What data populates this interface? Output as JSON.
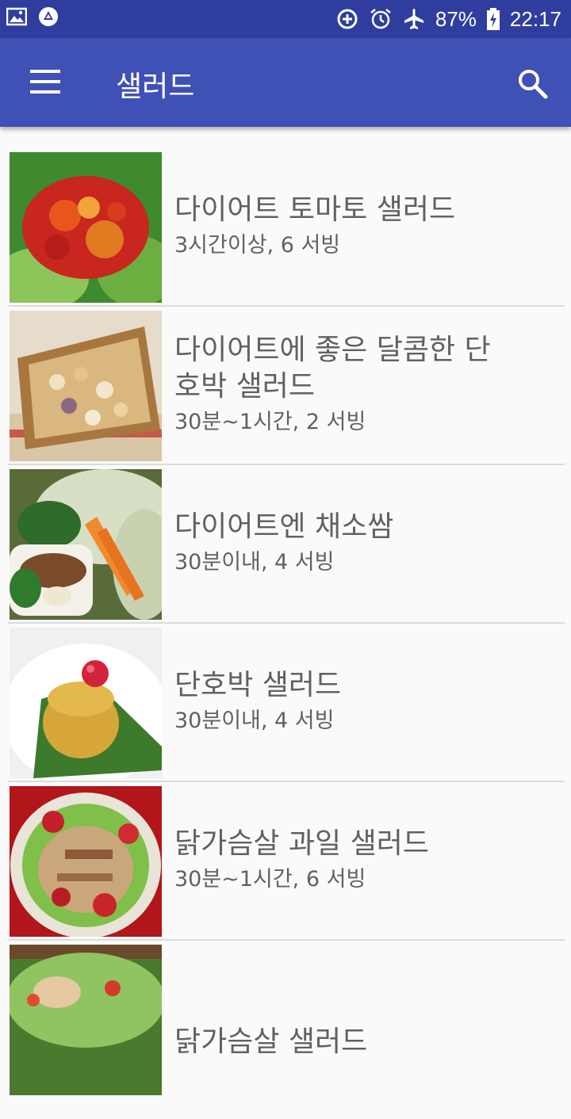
{
  "status_bar": {
    "icons_left": [
      "gallery-icon",
      "drive-icon"
    ],
    "battery_percent": "87%",
    "time": "22:17",
    "icons_right": [
      "data-saver-icon",
      "alarm-icon",
      "airplane-mode-icon",
      "battery-charging-icon"
    ]
  },
  "app_bar": {
    "title": "샐러드",
    "menu_icon": "hamburger-menu-icon",
    "search_icon": "search-icon"
  },
  "recipes": [
    {
      "name": "다이어트 토마토 샐러드",
      "meta": "3시간이상, 6 서빙"
    },
    {
      "name": "다이어트에 좋은 달콤한 단호박 샐러드",
      "meta": "30분~1시간, 2 서빙"
    },
    {
      "name": "다이어트엔 채소쌈",
      "meta": "30분이내, 4 서빙"
    },
    {
      "name": "단호박 샐러드",
      "meta": "30분이내, 4 서빙"
    },
    {
      "name": "닭가슴살 과일 샐러드",
      "meta": "30분~1시간, 6 서빙"
    },
    {
      "name": "닭가슴살 샐러드",
      "meta": ""
    }
  ],
  "colors": {
    "status_bar": "#2f3e9e",
    "app_bar": "#3f51b5",
    "background": "#fafafa",
    "text": "#616161"
  }
}
